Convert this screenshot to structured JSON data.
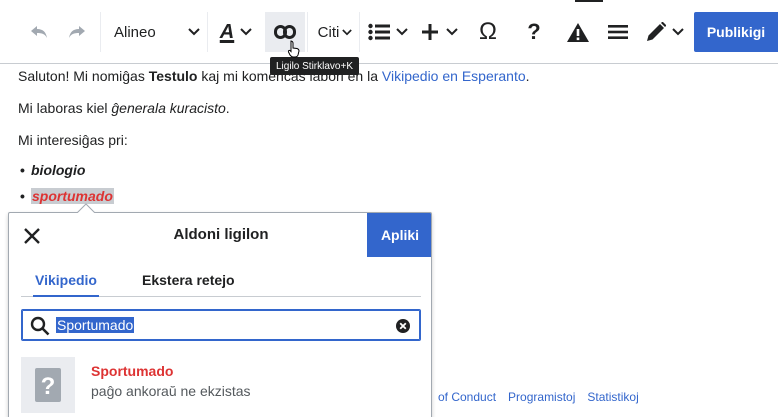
{
  "toolbar": {
    "paragraph_label": "Alineo",
    "cite_label": "Citi",
    "publish_label": "Publikigi",
    "tooltip": "Ligilo Stirklavo+K",
    "special_char": "Ω",
    "help_char": "?",
    "colors": {
      "accent": "#3366cc",
      "disabled": "#a2a9b1"
    }
  },
  "content": {
    "p1_before": "Saluton! Mi nomiĝas ",
    "p1_bold": "Testulo",
    "p1_middle": " kaj mi komencas labori en la ",
    "p1_link": "Vikipedio en Esperanto",
    "p1_after": ".",
    "p2_before": "Mi laboras kiel ",
    "p2_italic": "ĝenerala kuracisto",
    "p2_after": ".",
    "p3": "Mi interesiĝas pri:",
    "list": [
      "biologio",
      "sportumado"
    ]
  },
  "footer": {
    "links": [
      "of Conduct",
      "Programistoj",
      "Statistikoj"
    ]
  },
  "popup": {
    "title": "Aldoni ligilon",
    "apply_label": "Apliki",
    "tabs": [
      "Vikipedio",
      "Ekstera retejo"
    ],
    "search_value": "Sportumado",
    "result": {
      "title": "Sportumado",
      "description": "paĝo ankoraŭ ne ekzistas"
    }
  }
}
